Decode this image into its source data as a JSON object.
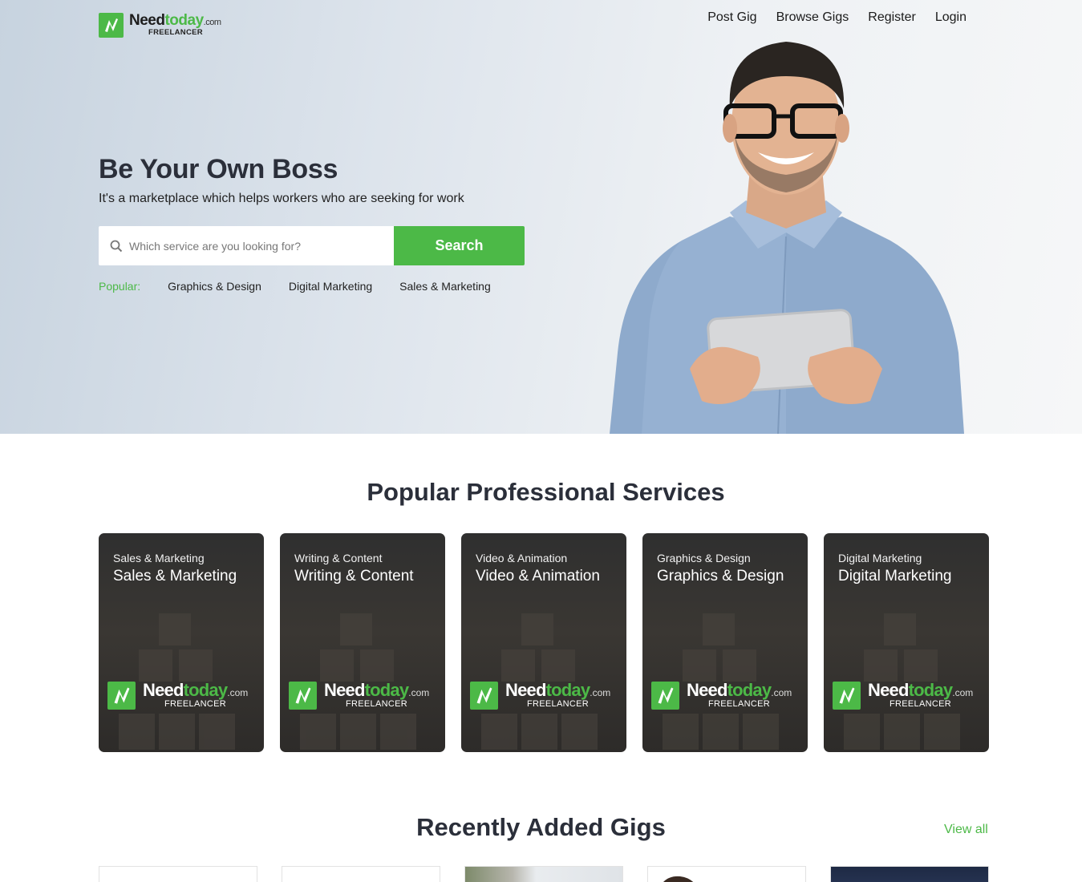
{
  "brand": {
    "need": "Need",
    "today": "today",
    "com": ".com",
    "tagline": "FREELANCER",
    "accent_color": "#4cb947"
  },
  "nav": {
    "items": [
      {
        "label": "Post Gig"
      },
      {
        "label": "Browse Gigs"
      },
      {
        "label": "Register"
      },
      {
        "label": "Login"
      }
    ]
  },
  "hero": {
    "title": "Be Your Own Boss",
    "subtitle": "It's a marketplace which helps workers who are seeking for work",
    "search_placeholder": "Which service are you looking for?",
    "search_value": "",
    "search_button": "Search",
    "popular_label": "Popular:",
    "popular_items": [
      "Graphics & Design",
      "Digital Marketing",
      "Sales & Marketing"
    ]
  },
  "services": {
    "title": "Popular Professional Services",
    "cards": [
      {
        "category": "Sales & Marketing",
        "name": "Sales & Marketing"
      },
      {
        "category": "Writing & Content",
        "name": "Writing & Content"
      },
      {
        "category": "Video & Animation",
        "name": "Video & Animation"
      },
      {
        "category": "Graphics & Design",
        "name": "Graphics & Design"
      },
      {
        "category": "Digital Marketing",
        "name": "Digital Marketing"
      }
    ]
  },
  "gigs": {
    "title": "Recently Added Gigs",
    "view_all": "View all"
  }
}
